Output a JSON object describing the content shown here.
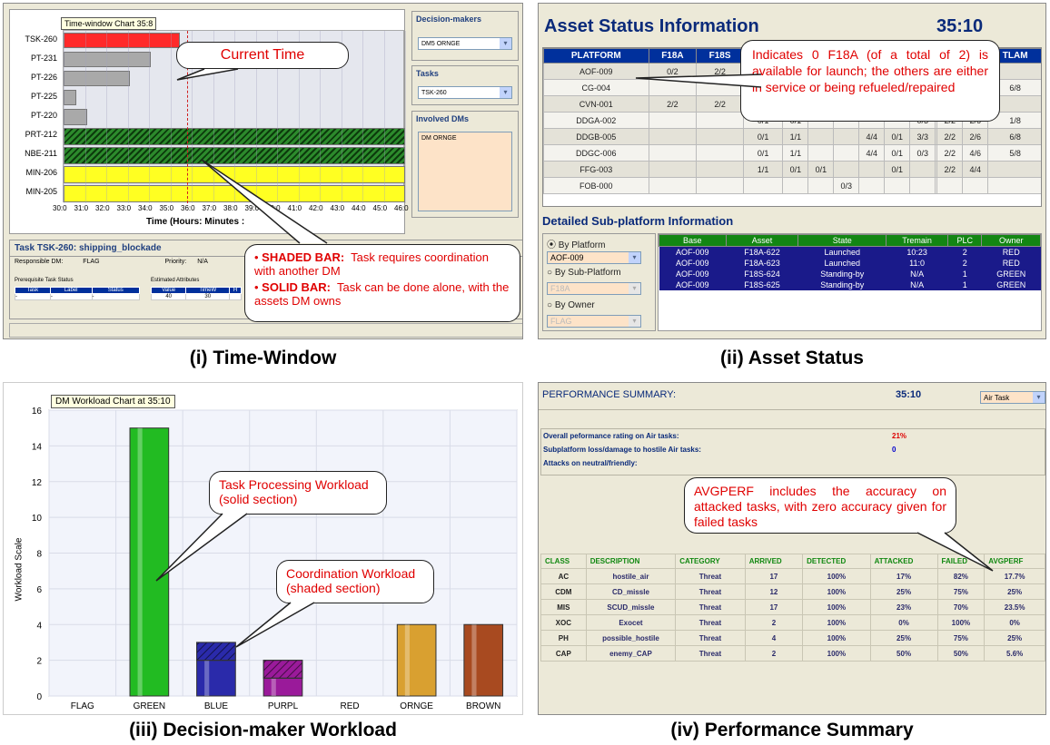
{
  "captions": {
    "p1": "(i) Time-Window",
    "p2": "(ii) Asset Status",
    "p3": "(iii) Decision-maker Workload",
    "p4": "(iv) Performance Summary"
  },
  "time_window": {
    "chart_title": "Time-window Chart 35:8",
    "tasks": [
      "TSK-260",
      "PT-231",
      "PT-226",
      "PT-225",
      "PT-220",
      "PRT-212",
      "NBE-211",
      "MIN-206",
      "MIN-205"
    ],
    "bar_kinds": [
      "red",
      "gray",
      "gray",
      "gray",
      "gray",
      "shaded",
      "shaded",
      "yellow",
      "yellow"
    ],
    "bar_ends": [
      35.45,
      34.1,
      33.1,
      30.6,
      31.1,
      46.2,
      46.2,
      46.2,
      46.2
    ],
    "x_start": 30.0,
    "x_end": 46.0,
    "current_time": 35.8,
    "x_ticks": [
      "30:0",
      "31:0",
      "32:0",
      "33:0",
      "34:0",
      "35:0",
      "36:0",
      "37:0",
      "38:0",
      "39:0",
      "40:0",
      "41:0",
      "42:0",
      "43:0",
      "44:0",
      "45:0",
      "46:0"
    ],
    "x_label": "Time (Hours: Minutes :",
    "side": {
      "dm_header": "Decision-makers",
      "dm_value": "DM5 ORNGE",
      "tasks_header": "Tasks",
      "tasks_value": "TSK-260",
      "involved_header": "Involved DMs",
      "involved_value": "DM ORNGE"
    },
    "task_panel": {
      "title": "Task TSK-260: shipping_blockade",
      "resp_label": "Responsible DM:",
      "resp_value": "FLAG",
      "priority_label": "Priority:",
      "priority_value": "N/A",
      "prereq_label": "Prerequisite Task Status",
      "prereq_cols": [
        "Task",
        "Label",
        "Status"
      ],
      "prereq_row": [
        "-",
        "-",
        "-"
      ],
      "est_label": "Estimated Attributes",
      "est_cols": [
        "Value",
        "TimeW",
        "H"
      ],
      "est_row": [
        "40",
        "30",
        ""
      ]
    },
    "callout_current": "Current Time",
    "callout_bars": {
      "shaded_key": "SHADED BAR:",
      "shaded_text": "Task requires coordination with another DM",
      "solid_key": "SOLID BAR:",
      "solid_text": "Task can be done alone, with the assets DM owns"
    }
  },
  "asset_status": {
    "title": "Asset Status Information",
    "time": "35:10",
    "columns": [
      "PLATFORM",
      "F18A",
      "F18S",
      "FAR",
      "",
      "",
      "",
      "",
      "",
      "",
      "",
      "",
      "",
      "TLAM"
    ],
    "rows": [
      [
        "AOF-009",
        "0/2",
        "2/2",
        "",
        "",
        "",
        "",
        "",
        "",
        "",
        "",
        "",
        "",
        ""
      ],
      [
        "CG-004",
        "",
        "",
        "1/1",
        "1/1",
        "",
        "",
        "",
        "",
        "",
        "",
        "",
        "",
        "6/8"
      ],
      [
        "CVN-001",
        "2/2",
        "2/2",
        "1/1",
        "1/1",
        "",
        "",
        "",
        "",
        "",
        "",
        "",
        "",
        ""
      ],
      [
        "DDGA-002",
        "",
        "",
        "0/1",
        "0/1",
        "",
        "",
        "",
        "",
        "0/3",
        "",
        "2/2",
        "2/6",
        "1/8"
      ],
      [
        "DDGB-005",
        "",
        "",
        "0/1",
        "1/1",
        "",
        "",
        "4/4",
        "0/1",
        "3/3",
        "",
        "2/2",
        "2/6",
        "6/8"
      ],
      [
        "DDGC-006",
        "",
        "",
        "0/1",
        "1/1",
        "",
        "",
        "4/4",
        "0/1",
        "0/3",
        "",
        "2/2",
        "4/6",
        "5/8"
      ],
      [
        "FFG-003",
        "",
        "",
        "1/1",
        "0/1",
        "0/1",
        "",
        "",
        "0/1",
        "",
        "",
        "2/2",
        "4/4",
        ""
      ],
      [
        "FOB-000",
        "",
        "",
        "",
        "",
        "",
        "0/3",
        "",
        "",
        "",
        "",
        "",
        "",
        ""
      ]
    ],
    "callout": "Indicates 0 F18A (of a total of 2) is available for launch;  the others are either in service or being refueled/repaired",
    "detail_title": "Detailed Sub-platform Information",
    "radio_platform": "By Platform",
    "platform_value": "AOF-009",
    "radio_sub": "By Sub-Platform",
    "sub_value": "F18A",
    "radio_owner": "By Owner",
    "owner_value": "FLAG",
    "detail_cols": [
      "Base",
      "Asset",
      "State",
      "Tremain",
      "PLC",
      "Owner"
    ],
    "detail_rows": [
      [
        "AOF-009",
        "F18A-622",
        "Launched",
        "10:23",
        "2",
        "RED"
      ],
      [
        "AOF-009",
        "F18A-623",
        "Launched",
        "11:0",
        "2",
        "RED"
      ],
      [
        "AOF-009",
        "F18S-624",
        "Standing-by",
        "N/A",
        "1",
        "GREEN"
      ],
      [
        "AOF-009",
        "F18S-625",
        "Standing-by",
        "N/A",
        "1",
        "GREEN"
      ]
    ]
  },
  "workload": {
    "chart_title": "DM Workload Chart at 35:10",
    "callout_task": "Task Processing Workload (solid section)",
    "callout_coord": "Coordination Workload (shaded section)"
  },
  "chart_data": {
    "type": "bar",
    "title": "DM Workload Chart at 35:10",
    "xlabel": "",
    "ylabel": "Workload Scale",
    "ylim": [
      0,
      16
    ],
    "yticks": [
      0,
      2,
      4,
      6,
      8,
      10,
      12,
      14,
      16
    ],
    "categories": [
      "FLAG",
      "GREEN",
      "BLUE",
      "PURPL",
      "RED",
      "ORNGE",
      "BROWN"
    ],
    "series": [
      {
        "values": [
          0,
          15,
          2,
          1,
          0,
          4,
          4
        ]
      },
      {
        "values": [
          0,
          0,
          1,
          1,
          0,
          0,
          0
        ]
      }
    ],
    "colors": [
      "#9a9a9a",
      "#22bb22",
      "#2a2aaa",
      "#9a1a9a",
      "#cc0000",
      "#d9a030",
      "#a84a20"
    ]
  },
  "perf": {
    "title": "PERFORMANCE SUMMARY:",
    "time": "35:10",
    "select": "Air Task",
    "rating_label": "Overall peformance rating on Air tasks:",
    "rating_value": "21%",
    "loss_label": "Subplatform loss/damage to hostile Air tasks:",
    "loss_value": "0",
    "attacks_label": "Attacks on neutral/friendly:",
    "callout": "AVGPERF includes the accuracy on attacked tasks, with zero accuracy given for failed tasks",
    "columns": [
      "CLASS",
      "DESCRIPTION",
      "CATEGORY",
      "ARRIVED",
      "DETECTED",
      "ATTACKED",
      "FAILED",
      "AVGPERF"
    ],
    "rows": [
      [
        "AC",
        "hostile_air",
        "Threat",
        "17",
        "100%",
        "17%",
        "82%",
        "17.7%"
      ],
      [
        "CDM",
        "CD_missle",
        "Threat",
        "12",
        "100%",
        "25%",
        "75%",
        "25%"
      ],
      [
        "MIS",
        "SCUD_missle",
        "Threat",
        "17",
        "100%",
        "23%",
        "70%",
        "23.5%"
      ],
      [
        "XOC",
        "Exocet",
        "Threat",
        "2",
        "100%",
        "0%",
        "100%",
        "0%"
      ],
      [
        "PH",
        "possible_hostile",
        "Threat",
        "4",
        "100%",
        "25%",
        "75%",
        "25%"
      ],
      [
        "CAP",
        "enemy_CAP",
        "Threat",
        "2",
        "100%",
        "50%",
        "50%",
        "5.6%"
      ]
    ]
  }
}
